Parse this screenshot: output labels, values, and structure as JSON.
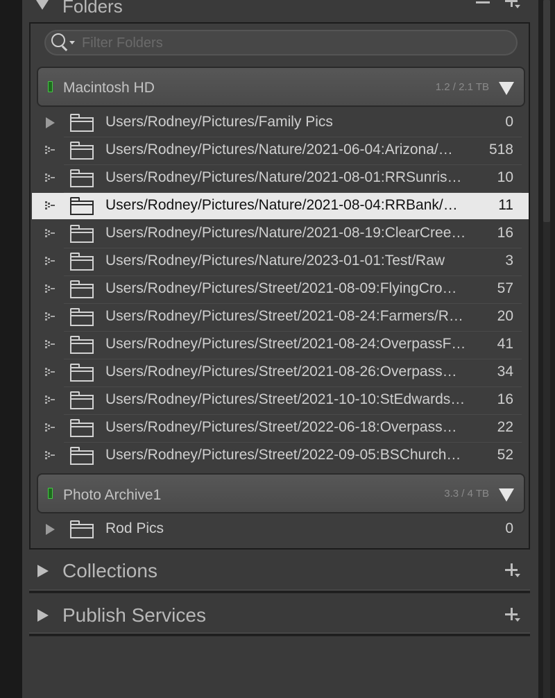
{
  "panel": {
    "folders_title": "Folders",
    "search_placeholder": "Filter Folders"
  },
  "volumes": [
    {
      "name": "Macintosh HD",
      "capacity": "1.2 / 2.1 TB",
      "status_color": "#48c548",
      "folders": [
        {
          "path": "Users/Rodney/Pictures/Family Pics",
          "count": "0",
          "expander": "triangle",
          "selected": false
        },
        {
          "path": "Users/Rodney/Pictures/Nature/2021-06-04:Arizona/…",
          "count": "518",
          "expander": "dots",
          "selected": false
        },
        {
          "path": "Users/Rodney/Pictures/Nature/2021-08-01:RRSunris…",
          "count": "10",
          "expander": "dots",
          "selected": false
        },
        {
          "path": "Users/Rodney/Pictures/Nature/2021-08-04:RRBank/…",
          "count": "11",
          "expander": "dots",
          "selected": true
        },
        {
          "path": "Users/Rodney/Pictures/Nature/2021-08-19:ClearCree…",
          "count": "16",
          "expander": "dots",
          "selected": false
        },
        {
          "path": "Users/Rodney/Pictures/Nature/2023-01-01:Test/Raw",
          "count": "3",
          "expander": "dots",
          "selected": false
        },
        {
          "path": "Users/Rodney/Pictures/Street/2021-08-09:FlyingCro…",
          "count": "57",
          "expander": "dots",
          "selected": false
        },
        {
          "path": "Users/Rodney/Pictures/Street/2021-08-24:Farmers/R…",
          "count": "20",
          "expander": "dots",
          "selected": false
        },
        {
          "path": "Users/Rodney/Pictures/Street/2021-08-24:OverpassF…",
          "count": "41",
          "expander": "dots",
          "selected": false
        },
        {
          "path": "Users/Rodney/Pictures/Street/2021-08-26:Overpass…",
          "count": "34",
          "expander": "dots",
          "selected": false
        },
        {
          "path": "Users/Rodney/Pictures/Street/2021-10-10:StEdwards…",
          "count": "16",
          "expander": "dots",
          "selected": false
        },
        {
          "path": "Users/Rodney/Pictures/Street/2022-06-18:Overpass…",
          "count": "22",
          "expander": "dots",
          "selected": false
        },
        {
          "path": "Users/Rodney/Pictures/Street/2022-09-05:BSChurch…",
          "count": "52",
          "expander": "dots",
          "selected": false
        }
      ]
    },
    {
      "name": "Photo Archive1",
      "capacity": "3.3 / 4 TB",
      "status_color": "#48c548",
      "folders": [
        {
          "path": "Rod Pics",
          "count": "0",
          "expander": "triangle",
          "selected": false
        }
      ]
    }
  ],
  "sections": [
    {
      "title": "Collections"
    },
    {
      "title": "Publish Services"
    }
  ],
  "colors": {
    "panel_bg": "#3a3a3a",
    "selected_row_bg": "#e8e8e8",
    "text": "#cfcfcf",
    "status_led": "#48c548"
  },
  "icons": [
    "collapse-triangle-icon",
    "minus-icon",
    "plus-dropdown-icon",
    "search-icon",
    "folder-icon",
    "expand-triangle-icon",
    "drag-dots-icon",
    "volume-status-led-icon",
    "volume-expand-icon"
  ]
}
